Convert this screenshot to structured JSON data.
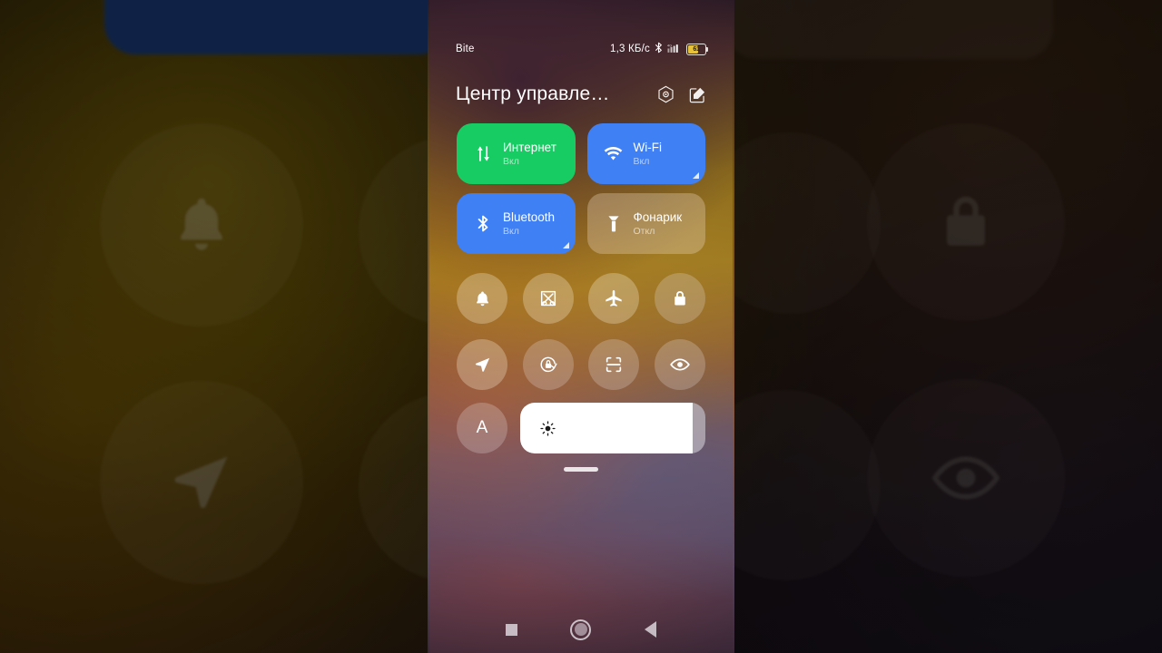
{
  "status_bar": {
    "carrier": "Bite",
    "network_speed": "1,3 КБ/с",
    "bluetooth_icon": "bluetooth-icon",
    "signal_icon": "cellular-signal-icon",
    "signal_label": "4G",
    "battery_percent": "61"
  },
  "header": {
    "title": "Центр управле…",
    "settings_icon": "control-center-settings-icon",
    "edit_icon": "edit-icon"
  },
  "tiles": [
    {
      "id": "internet",
      "icon": "data-transfer-icon",
      "label": "Интернет",
      "state": "Вкл",
      "style": "on-green",
      "expandable": false
    },
    {
      "id": "wifi",
      "icon": "wifi-icon",
      "label": "Wi-Fi",
      "state": "Вкл",
      "style": "on-blue",
      "expandable": true
    },
    {
      "id": "bluetooth",
      "icon": "bluetooth-icon",
      "label": "Bluetooth",
      "state": "Вкл",
      "style": "on-blue",
      "expandable": true
    },
    {
      "id": "flashlight",
      "icon": "flashlight-icon",
      "label": "Фонарик",
      "state": "Откл",
      "style": "off",
      "expandable": false
    }
  ],
  "toggles_row_1": [
    {
      "id": "sound",
      "icon": "bell-icon"
    },
    {
      "id": "screenshot",
      "icon": "screenshot-scissors-icon"
    },
    {
      "id": "airplane",
      "icon": "airplane-icon"
    },
    {
      "id": "lock",
      "icon": "lock-icon"
    }
  ],
  "toggles_row_2": [
    {
      "id": "location",
      "icon": "location-arrow-icon"
    },
    {
      "id": "autorotate",
      "icon": "rotation-lock-icon"
    },
    {
      "id": "scan",
      "icon": "scan-frame-icon"
    },
    {
      "id": "reading-mode",
      "icon": "eye-icon"
    }
  ],
  "brightness": {
    "auto_label": "A",
    "auto_icon": "auto-brightness-icon",
    "slider_icon": "sun-icon",
    "fill_percent": "93"
  },
  "drag_handle": {
    "name": "drag-handle"
  },
  "nav_bar": {
    "recents_icon": "recents-square-icon",
    "home_icon": "home-circle-icon",
    "back_icon": "back-triangle-icon"
  },
  "colors": {
    "tile_on_green": "#17cc63",
    "tile_on_blue": "#4080f5",
    "tile_off": "rgba(235,215,190,0.34)",
    "battery_fill": "#e8c33a"
  }
}
